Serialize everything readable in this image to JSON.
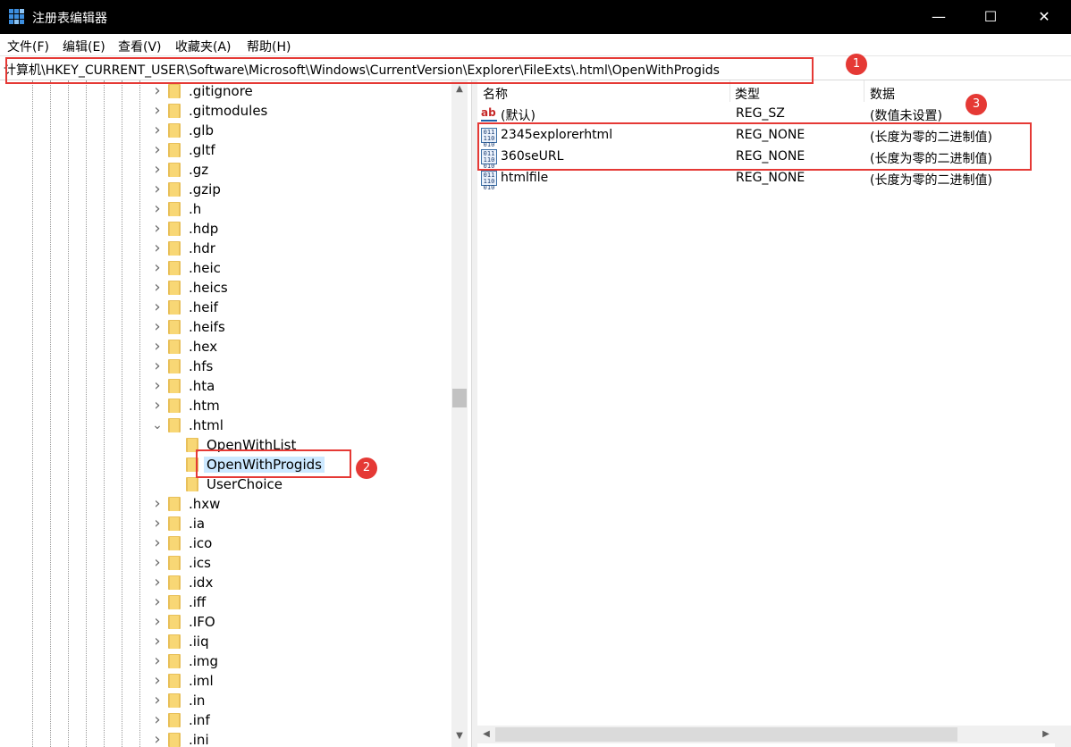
{
  "window": {
    "title": "注册表编辑器",
    "minimize_glyph": "—",
    "maximize_glyph": "☐",
    "close_glyph": "✕"
  },
  "menu": [
    "文件(F)",
    "编辑(E)",
    "查看(V)",
    "收藏夹(A)",
    "帮助(H)"
  ],
  "address": "计算机\\HKEY_CURRENT_USER\\Software\\Microsoft\\Windows\\CurrentVersion\\Explorer\\FileExts\\.html\\OpenWithProgids",
  "annotations": [
    "1",
    "2",
    "3"
  ],
  "tree": {
    "items_before": [
      ".gitignore",
      ".gitmodules",
      ".glb",
      ".gltf",
      ".gz",
      ".gzip",
      ".h",
      ".hdp",
      ".hdr",
      ".heic",
      ".heics",
      ".heif",
      ".heifs",
      ".hex",
      ".hfs",
      ".hta",
      ".htm"
    ],
    "expanded": ".html",
    "children": [
      "OpenWithList",
      "OpenWithProgids",
      "UserChoice"
    ],
    "selected": "OpenWithProgids",
    "items_after": [
      ".hxw",
      ".ia",
      ".ico",
      ".ics",
      ".idx",
      ".iff",
      ".IFO",
      ".iiq",
      ".img",
      ".iml",
      ".in",
      ".inf",
      ".ini"
    ]
  },
  "list": {
    "headers": [
      "名称",
      "类型",
      "数据"
    ],
    "rows": [
      {
        "icon": "string-value-icon",
        "name": "(默认)",
        "type": "REG_SZ",
        "data": "(数值未设置)"
      },
      {
        "icon": "binary-value-icon",
        "name": "2345explorerhtml",
        "type": "REG_NONE",
        "data": "(长度为零的二进制值)"
      },
      {
        "icon": "binary-value-icon",
        "name": "360seURL",
        "type": "REG_NONE",
        "data": "(长度为零的二进制值)"
      },
      {
        "icon": "binary-value-icon",
        "name": "htmlfile",
        "type": "REG_NONE",
        "data": "(长度为零的二进制值)"
      }
    ]
  },
  "colors": {
    "accent": "#e53935",
    "selection": "#cce8ff",
    "folder": "#f8d775"
  }
}
